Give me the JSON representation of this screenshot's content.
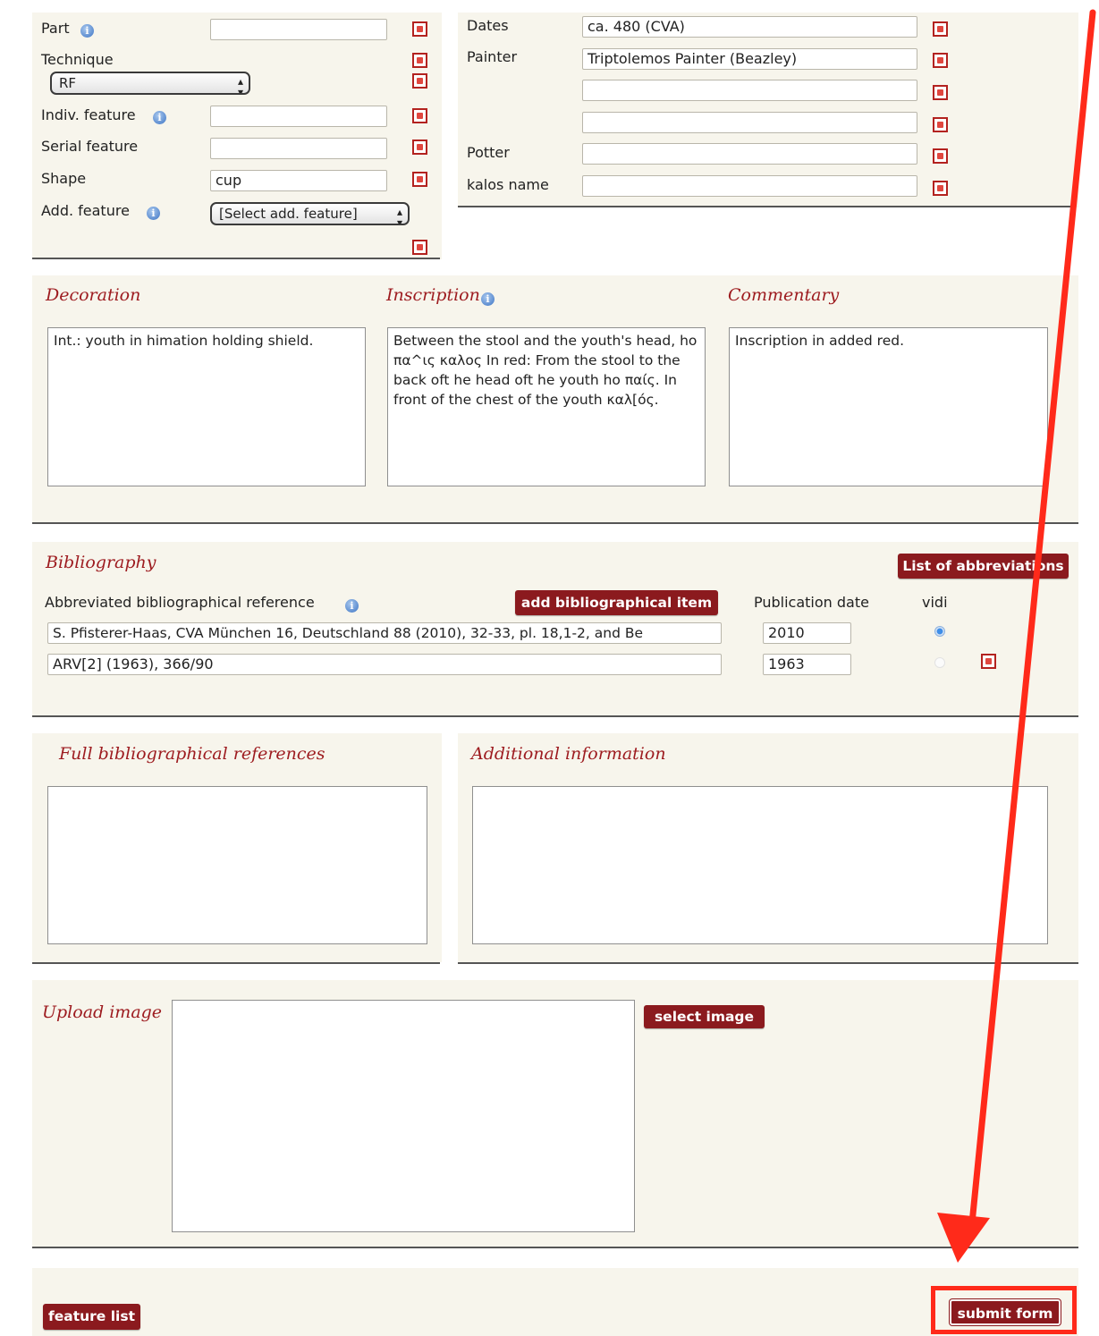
{
  "form_left": {
    "part_label": "Part",
    "technique_label": "Technique",
    "technique_value": "RF",
    "indiv_feature_label": "Indiv. feature",
    "serial_feature_label": "Serial feature",
    "shape_label": "Shape",
    "shape_value": "cup",
    "add_feature_label": "Add. feature",
    "add_feature_value": "[Select add. feature]"
  },
  "form_right": {
    "dates_label": "Dates",
    "dates_value": "ca. 480 (CVA)",
    "painter_label": "Painter",
    "painter_value": "Triptolemos Painter (Beazley)",
    "potter_label": "Potter",
    "kalos_label": "kalos name"
  },
  "decoration": {
    "title": "Decoration",
    "text": "Int.: youth in himation holding shield."
  },
  "inscription": {
    "title": "Inscription",
    "text": "Between the stool and the youth's head, ho πα^ις καλος In red: From the stool to the back oft he head oft he youth ho παίς. In front of the chest of the youth καλ[ός."
  },
  "commentary": {
    "title": "Commentary",
    "text": "Inscription in added red."
  },
  "bibliography": {
    "title": "Bibliography",
    "abbrev_button": "List of abbreviations",
    "ref_header": "Abbreviated bibliographical reference",
    "add_button": "add bibliographical item",
    "pubdate_header": "Publication date",
    "vidi_header": "vidi",
    "rows": [
      {
        "ref": "S. Pfisterer-Haas, CVA München 16, Deutschland 88 (2010), 32-33, pl. 18,1-2, and Be",
        "date": "2010"
      },
      {
        "ref": "ARV[2] (1963), 366/90",
        "date": "1963"
      }
    ]
  },
  "full_refs": {
    "title": "Full bibliographical references"
  },
  "additional": {
    "title": "Additional information"
  },
  "upload": {
    "title": "Upload image",
    "select_button": "select image"
  },
  "footer": {
    "feature_list": "feature list",
    "submit": "submit form"
  },
  "colors": {
    "accent": "#8b1a1e",
    "annotation": "#ff2a1a",
    "panel": "#f7f5ec"
  }
}
